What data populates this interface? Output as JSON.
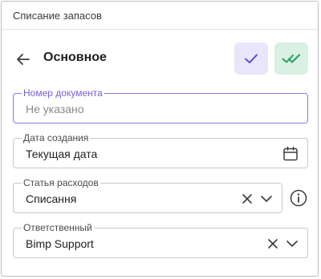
{
  "window": {
    "title": "Списание запасов"
  },
  "header": {
    "title": "Основное"
  },
  "icons": {
    "back": "arrow-left-icon",
    "save": "check-icon",
    "save_close": "double-check-icon",
    "calendar": "calendar-icon",
    "clear": "close-icon",
    "dropdown": "chevron-down-icon",
    "info": "info-icon"
  },
  "colors": {
    "accent": "#7a5ed6",
    "save_bg": "#e9e6fb",
    "save_close_bg": "#d8f1e2",
    "save_close_fg": "#2e9d5b"
  },
  "fields": {
    "doc_number": {
      "label": "Номер документа",
      "placeholder": "Не указано",
      "value": ""
    },
    "created_date": {
      "label": "Дата создания",
      "value": "Текущая дата"
    },
    "expense_item": {
      "label": "Статья расходов",
      "value": "Списання"
    },
    "responsible": {
      "label": "Ответственный",
      "value": "Bimp Support"
    }
  }
}
